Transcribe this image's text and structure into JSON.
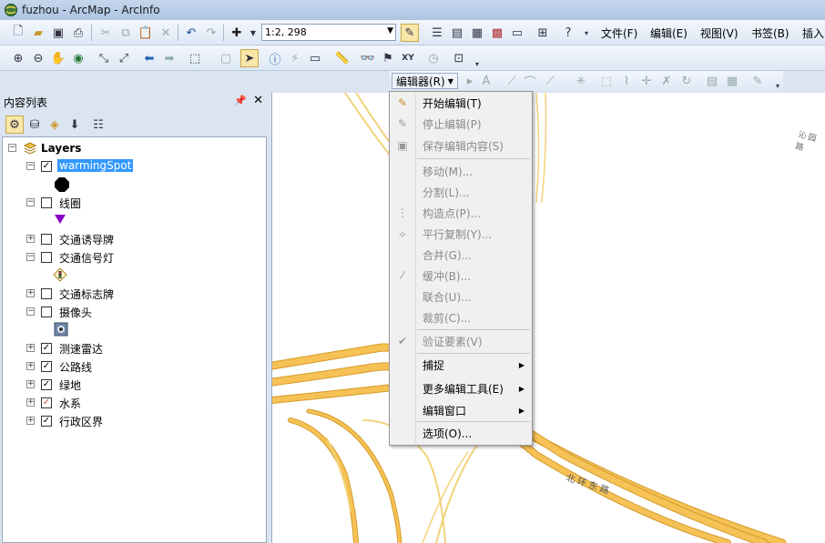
{
  "window": {
    "title": "fuzhou - ArcMap - ArcInfo"
  },
  "toolbar": {
    "scale_value": "1:2, 298",
    "menus": [
      "文件(F)",
      "编辑(E)",
      "视图(V)",
      "书签(B)",
      "插入"
    ]
  },
  "editor_toolbar": {
    "label": "编辑器(R)"
  },
  "toc": {
    "title": "内容列表",
    "root": "Layers",
    "layers": [
      {
        "name": "warmingSpot",
        "checked": true,
        "expanded": true,
        "selected": true
      },
      {
        "name": "线圈",
        "checked": false,
        "expanded": true
      },
      {
        "name": "交通诱导牌",
        "checked": false,
        "expanded": false
      },
      {
        "name": "交通信号灯",
        "checked": false,
        "expanded": true
      },
      {
        "name": "交通标志牌",
        "checked": false,
        "expanded": false
      },
      {
        "name": "摄像头",
        "checked": false,
        "expanded": true
      },
      {
        "name": "测速雷达",
        "checked": true,
        "expanded": false
      },
      {
        "name": "公路线",
        "checked": true,
        "expanded": false
      },
      {
        "name": "绿地",
        "checked": true,
        "expanded": false
      },
      {
        "name": "水系",
        "checked": true,
        "expanded": false
      },
      {
        "name": "行政区界",
        "checked": true,
        "expanded": false
      }
    ]
  },
  "map": {
    "road_labels": [
      "北环东路",
      "沁园路"
    ]
  },
  "editor_menu": {
    "items": [
      {
        "label": "开始编辑(T)",
        "enabled": true,
        "icon": "pencil-icon"
      },
      {
        "label": "停止编辑(P)",
        "enabled": false,
        "icon": "pencil-stop-icon"
      },
      {
        "label": "保存编辑内容(S)",
        "enabled": false,
        "icon": "save-icon"
      },
      {
        "label": "移动(M)...",
        "enabled": false
      },
      {
        "label": "分割(L)...",
        "enabled": false
      },
      {
        "label": "构造点(P)...",
        "enabled": false,
        "icon": "construct-points-icon"
      },
      {
        "label": "平行复制(Y)...",
        "enabled": false,
        "icon": "copy-parallel-icon"
      },
      {
        "label": "合并(G)...",
        "enabled": false
      },
      {
        "label": "缓冲(B)...",
        "enabled": false,
        "icon": "buffer-icon"
      },
      {
        "label": "联合(U)...",
        "enabled": false
      },
      {
        "label": "裁剪(C)...",
        "enabled": false
      },
      {
        "label": "验证要素(V)",
        "enabled": false,
        "icon": "validate-icon"
      },
      {
        "label": "捕捉",
        "enabled": true,
        "submenu": true
      },
      {
        "label": "更多编辑工具(E)",
        "enabled": true,
        "submenu": true
      },
      {
        "label": "编辑窗口",
        "enabled": true,
        "submenu": true
      },
      {
        "label": "选项(O)...",
        "enabled": true
      }
    ]
  },
  "colors": {
    "road_fill": "#f6c255",
    "road_edge": "#d49a2a",
    "selection": "#3399ff",
    "point_symbol": "#000000",
    "coil_symbol": "#8a00c8"
  }
}
